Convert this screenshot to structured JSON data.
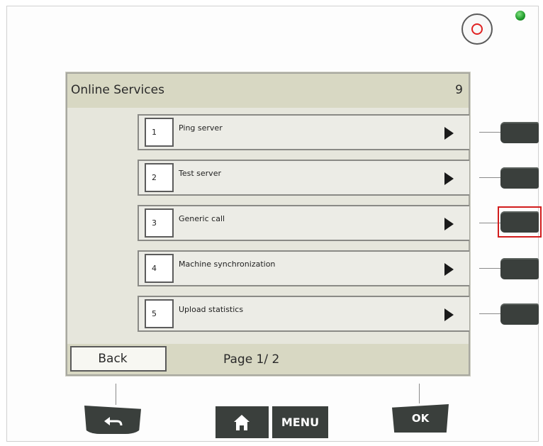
{
  "screen": {
    "title": "Online Services",
    "count": "9",
    "items": [
      {
        "number": "1",
        "label": "Ping server"
      },
      {
        "number": "2",
        "label": "Test server"
      },
      {
        "number": "3",
        "label": "Generic call"
      },
      {
        "number": "4",
        "label": "Machine synchronization"
      },
      {
        "number": "5",
        "label": "Upload statistics"
      }
    ],
    "footer": {
      "back_label": "Back",
      "page_info": "Page 1/ 2"
    }
  },
  "softkeys": {
    "selected_index": 3,
    "highlight_color": "#d21d1d"
  },
  "hard_buttons": {
    "menu_label": "MENU",
    "ok_label": "OK",
    "back_icon": "return-arrow-icon",
    "home_icon": "home-icon"
  },
  "indicators": {
    "power_icon": "power-ring-icon",
    "led_color": "#1f9a2a"
  }
}
